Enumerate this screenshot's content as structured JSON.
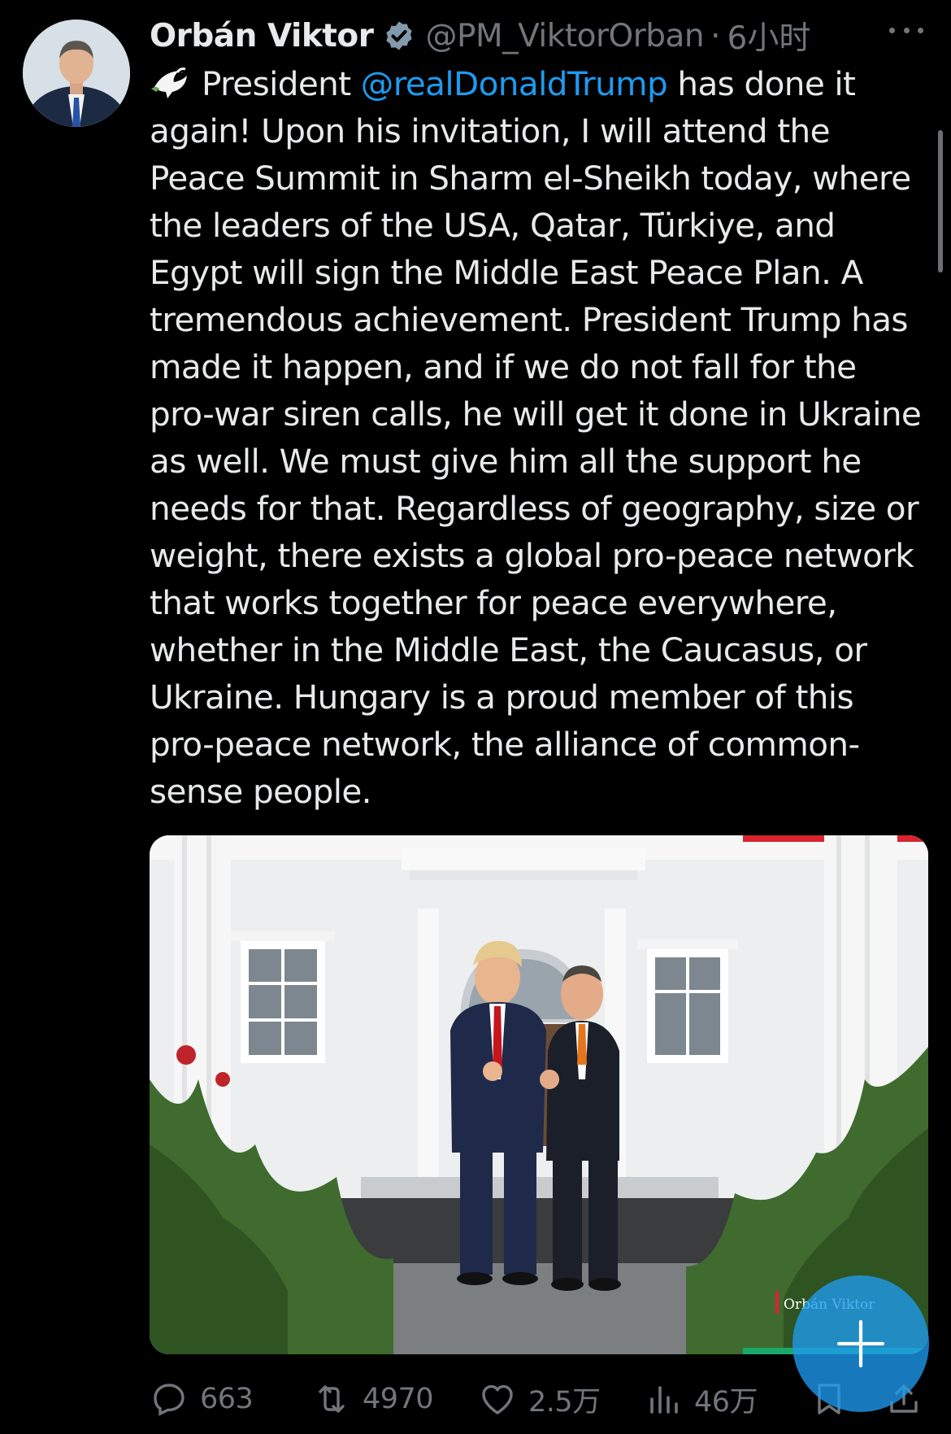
{
  "tweet": {
    "author_name": "Orbán Viktor",
    "handle": "@PM_ViktorOrban",
    "separator": "·",
    "time": "6小时",
    "body_lines": [
      {
        "before": "President ",
        "mention": "@realDonaldTrump",
        "after": " has done it"
      },
      "again! Upon his invitation, I will attend the",
      "Peace Summit in Sharm el-Sheikh today, where",
      "the leaders of the USA, Qatar, Türkiye, and",
      "Egypt will sign the Middle East Peace Plan. A",
      "tremendous achievement. President Trump has",
      "made it happen, and if we do not fall for the",
      "pro-war siren calls, he will get it done in Ukraine",
      "as well. We must give him all the support he",
      "needs for that. Regardless of geography, size or",
      "weight, there exists a global pro-peace network",
      "that works together for peace everywhere,",
      "whether in the Middle East, the Caucasus, or",
      "Ukraine. Hungary is a proud member of this",
      "pro-peace network, the alliance of common-",
      "sense people."
    ],
    "photo_watermark": "Orbán Viktor"
  },
  "actions": {
    "replies": "663",
    "retweets": "4970",
    "likes": "2.5万",
    "views": "46万"
  },
  "icons": {
    "emoji": "dove-icon",
    "verified": "verified-badge-icon",
    "more": "more-icon",
    "reply": "reply-icon",
    "retweet": "retweet-icon",
    "like": "heart-icon",
    "views": "views-icon",
    "bookmark": "bookmark-icon",
    "share": "share-icon",
    "compose": "plus-icon"
  },
  "colors": {
    "background": "#000000",
    "text": "#e7e9ea",
    "secondary": "#71767b",
    "link": "#1d9bf0"
  }
}
